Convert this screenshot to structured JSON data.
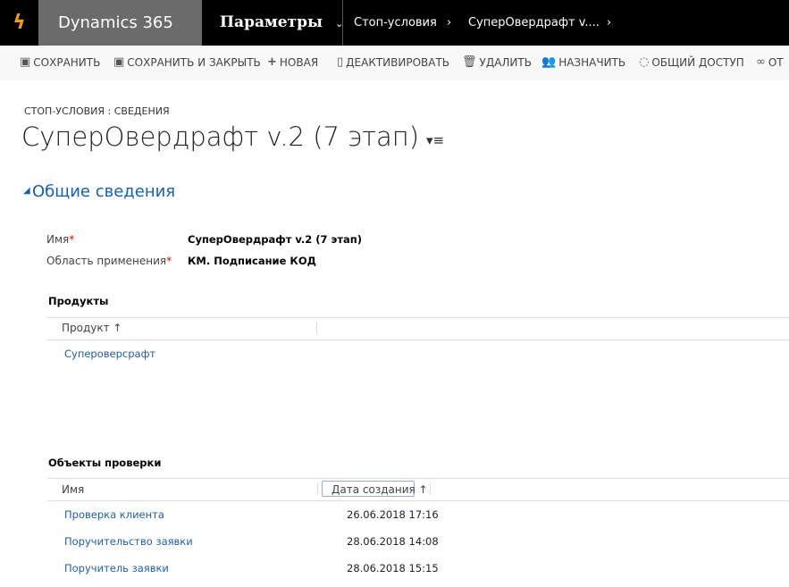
{
  "nav": {
    "app_title": "Dynamics 365",
    "area": "Параметры",
    "breadcrumbs": [
      "Стоп-условия",
      "СуперОвердрафт v...."
    ]
  },
  "toolbar": [
    {
      "icon": "save-icon",
      "label": "СОХРАНИТЬ"
    },
    {
      "icon": "save-close-icon",
      "label": "СОХРАНИТЬ И ЗАКРЫТЬ"
    },
    {
      "icon": "plus-icon",
      "label": "НОВАЯ"
    },
    {
      "icon": "deactivate-icon",
      "label": "ДЕАКТИВИРОВАТЬ"
    },
    {
      "icon": "trash-icon",
      "label": "УДАЛИТЬ"
    },
    {
      "icon": "assign-icon",
      "label": "НАЗНАЧИТЬ"
    },
    {
      "icon": "share-icon",
      "label": "ОБЩИЙ ДОСТУП"
    },
    {
      "icon": "link-icon",
      "label": "ОТ"
    }
  ],
  "form": {
    "entity_label": "СТОП-УСЛОВИЯ : СВЕДЕНИЯ",
    "title": "СуперОвердрафт v.2 (7 этап)",
    "section": "Общие сведения",
    "fields": [
      {
        "label": "Имя",
        "value": "СуперОвердрафт v.2 (7 этап)",
        "required": true
      },
      {
        "label": "Область применения",
        "value": "КМ. Подписание КОД",
        "required": true
      }
    ]
  },
  "products": {
    "label": "Продукты",
    "column": "Продукт ↑",
    "rows": [
      "Супероверсрафт"
    ]
  },
  "objects": {
    "label": "Объекты проверки",
    "columns": [
      "Имя",
      "Дата создания ↑"
    ],
    "rows": [
      {
        "name": "Проверка клиента",
        "date": "26.06.2018 17:16"
      },
      {
        "name": "Поручительство заявки",
        "date": "28.06.2018 14:08"
      },
      {
        "name": "Поручитель заявки",
        "date": "28.06.2018 15:15"
      }
    ]
  }
}
